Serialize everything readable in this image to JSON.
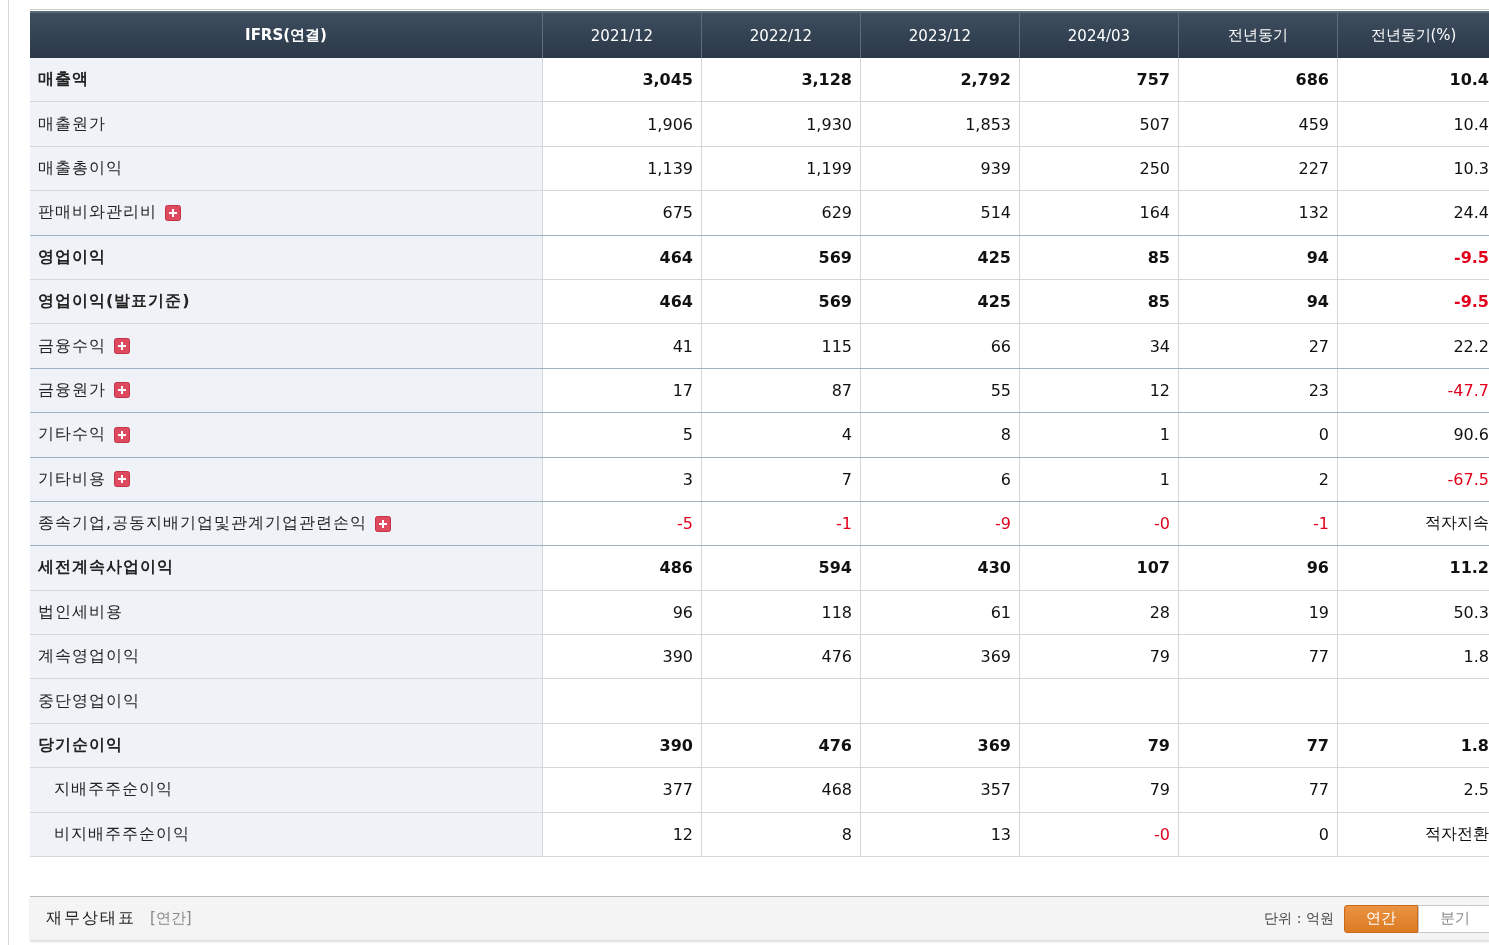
{
  "table": {
    "columns": [
      "IFRS(연결)",
      "2021/12",
      "2022/12",
      "2023/12",
      "2024/03",
      "전년동기",
      "전년동기(%)"
    ],
    "rows": [
      {
        "label": "매출액",
        "bold": true,
        "expandable": false,
        "cells": [
          {
            "value": "3,045",
            "negative": false
          },
          {
            "value": "3,128",
            "negative": false
          },
          {
            "value": "2,792",
            "negative": false
          },
          {
            "value": "757",
            "negative": false
          },
          {
            "value": "686",
            "negative": false
          },
          {
            "value": "10.4",
            "negative": false
          }
        ]
      },
      {
        "label": "매출원가",
        "bold": false,
        "expandable": false,
        "cells": [
          {
            "value": "1,906",
            "negative": false
          },
          {
            "value": "1,930",
            "negative": false
          },
          {
            "value": "1,853",
            "negative": false
          },
          {
            "value": "507",
            "negative": false
          },
          {
            "value": "459",
            "negative": false
          },
          {
            "value": "10.4",
            "negative": false
          }
        ]
      },
      {
        "label": "매출총이익",
        "bold": false,
        "expandable": false,
        "cells": [
          {
            "value": "1,139",
            "negative": false
          },
          {
            "value": "1,199",
            "negative": false
          },
          {
            "value": "939",
            "negative": false
          },
          {
            "value": "250",
            "negative": false
          },
          {
            "value": "227",
            "negative": false
          },
          {
            "value": "10.3",
            "negative": false
          }
        ]
      },
      {
        "label": "판매비와관리비",
        "bold": false,
        "expandable": true,
        "cells": [
          {
            "value": "675",
            "negative": false
          },
          {
            "value": "629",
            "negative": false
          },
          {
            "value": "514",
            "negative": false
          },
          {
            "value": "164",
            "negative": false
          },
          {
            "value": "132",
            "negative": false
          },
          {
            "value": "24.4",
            "negative": false
          }
        ]
      },
      {
        "label": "영업이익",
        "bold": true,
        "expandable": false,
        "cells": [
          {
            "value": "464",
            "negative": false
          },
          {
            "value": "569",
            "negative": false
          },
          {
            "value": "425",
            "negative": false
          },
          {
            "value": "85",
            "negative": false
          },
          {
            "value": "94",
            "negative": false
          },
          {
            "value": "-9.5",
            "negative": true
          }
        ]
      },
      {
        "label": "영업이익(발표기준)",
        "bold": true,
        "expandable": false,
        "cells": [
          {
            "value": "464",
            "negative": false
          },
          {
            "value": "569",
            "negative": false
          },
          {
            "value": "425",
            "negative": false
          },
          {
            "value": "85",
            "negative": false
          },
          {
            "value": "94",
            "negative": false
          },
          {
            "value": "-9.5",
            "negative": true
          }
        ]
      },
      {
        "label": "금융수익",
        "bold": false,
        "expandable": true,
        "cells": [
          {
            "value": "41",
            "negative": false
          },
          {
            "value": "115",
            "negative": false
          },
          {
            "value": "66",
            "negative": false
          },
          {
            "value": "34",
            "negative": false
          },
          {
            "value": "27",
            "negative": false
          },
          {
            "value": "22.2",
            "negative": false
          }
        ]
      },
      {
        "label": "금융원가",
        "bold": false,
        "expandable": true,
        "cells": [
          {
            "value": "17",
            "negative": false
          },
          {
            "value": "87",
            "negative": false
          },
          {
            "value": "55",
            "negative": false
          },
          {
            "value": "12",
            "negative": false
          },
          {
            "value": "23",
            "negative": false
          },
          {
            "value": "-47.7",
            "negative": true
          }
        ]
      },
      {
        "label": "기타수익",
        "bold": false,
        "expandable": true,
        "cells": [
          {
            "value": "5",
            "negative": false
          },
          {
            "value": "4",
            "negative": false
          },
          {
            "value": "8",
            "negative": false
          },
          {
            "value": "1",
            "negative": false
          },
          {
            "value": "0",
            "negative": false
          },
          {
            "value": "90.6",
            "negative": false
          }
        ]
      },
      {
        "label": "기타비용",
        "bold": false,
        "expandable": true,
        "cells": [
          {
            "value": "3",
            "negative": false
          },
          {
            "value": "7",
            "negative": false
          },
          {
            "value": "6",
            "negative": false
          },
          {
            "value": "1",
            "negative": false
          },
          {
            "value": "2",
            "negative": false
          },
          {
            "value": "-67.5",
            "negative": true
          }
        ]
      },
      {
        "label": "종속기업,공동지배기업및관계기업관련손익",
        "bold": false,
        "expandable": true,
        "cells": [
          {
            "value": "-5",
            "negative": true
          },
          {
            "value": "-1",
            "negative": true
          },
          {
            "value": "-9",
            "negative": true
          },
          {
            "value": "-0",
            "negative": true
          },
          {
            "value": "-1",
            "negative": true
          },
          {
            "value": "적자지속",
            "negative": false
          }
        ]
      },
      {
        "label": "세전계속사업이익",
        "bold": true,
        "expandable": false,
        "cells": [
          {
            "value": "486",
            "negative": false
          },
          {
            "value": "594",
            "negative": false
          },
          {
            "value": "430",
            "negative": false
          },
          {
            "value": "107",
            "negative": false
          },
          {
            "value": "96",
            "negative": false
          },
          {
            "value": "11.2",
            "negative": false
          }
        ]
      },
      {
        "label": "법인세비용",
        "bold": false,
        "expandable": false,
        "cells": [
          {
            "value": "96",
            "negative": false
          },
          {
            "value": "118",
            "negative": false
          },
          {
            "value": "61",
            "negative": false
          },
          {
            "value": "28",
            "negative": false
          },
          {
            "value": "19",
            "negative": false
          },
          {
            "value": "50.3",
            "negative": false
          }
        ]
      },
      {
        "label": "계속영업이익",
        "bold": false,
        "expandable": false,
        "cells": [
          {
            "value": "390",
            "negative": false
          },
          {
            "value": "476",
            "negative": false
          },
          {
            "value": "369",
            "negative": false
          },
          {
            "value": "79",
            "negative": false
          },
          {
            "value": "77",
            "negative": false
          },
          {
            "value": "1.8",
            "negative": false
          }
        ]
      },
      {
        "label": "중단영업이익",
        "bold": false,
        "expandable": false,
        "cells": []
      },
      {
        "label": "당기순이익",
        "bold": true,
        "expandable": false,
        "cells": [
          {
            "value": "390",
            "negative": false
          },
          {
            "value": "476",
            "negative": false
          },
          {
            "value": "369",
            "negative": false
          },
          {
            "value": "79",
            "negative": false
          },
          {
            "value": "77",
            "negative": false
          },
          {
            "value": "1.8",
            "negative": false
          }
        ],
        "children": [
          {
            "label": "지배주주순이익",
            "bold": false,
            "expandable": false,
            "cells": [
              {
                "value": "377",
                "negative": false
              },
              {
                "value": "468",
                "negative": false
              },
              {
                "value": "357",
                "negative": false
              },
              {
                "value": "79",
                "negative": false
              },
              {
                "value": "77",
                "negative": false
              },
              {
                "value": "2.5",
                "negative": false
              }
            ]
          },
          {
            "label": "비지배주주순이익",
            "bold": false,
            "expandable": false,
            "cells": [
              {
                "value": "12",
                "negative": false
              },
              {
                "value": "8",
                "negative": false
              },
              {
                "value": "13",
                "negative": false
              },
              {
                "value": "-0",
                "negative": true
              },
              {
                "value": "0",
                "negative": false
              },
              {
                "value": "적자전환",
                "negative": false
              }
            ]
          }
        ]
      }
    ]
  },
  "next_section": {
    "title": "재무상태표",
    "period": "[연간]",
    "unit": "단위 : 억원",
    "toggle": [
      {
        "label": "연간",
        "selected": true
      },
      {
        "label": "분기",
        "selected": false
      }
    ]
  }
}
